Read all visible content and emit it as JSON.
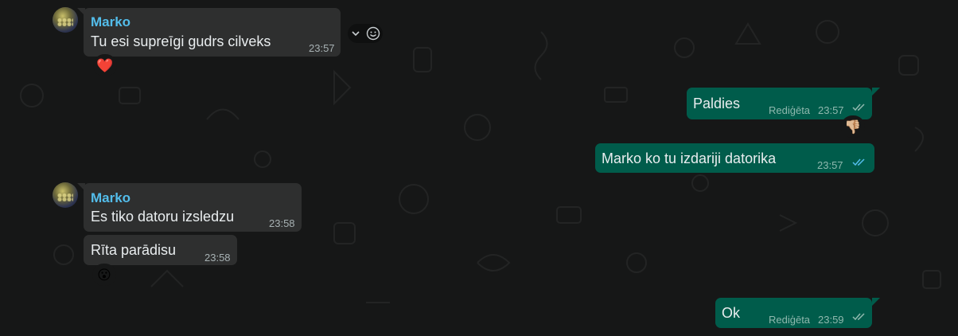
{
  "colors": {
    "background": "#161717",
    "incoming": "#2e2f2f",
    "outgoing": "#005c4b",
    "sender": "#53bdeb",
    "read_ticks": "#53bdeb"
  },
  "messages": [
    {
      "direction": "in",
      "sender": "Marko",
      "text": "Tu esi supreīgi gudrs cilveks",
      "time": "23:57",
      "reaction": "❤️"
    },
    {
      "direction": "out",
      "text": "Paldies",
      "edited": "Rediģēta",
      "time": "23:57",
      "reaction": "👎🏼",
      "status": "read"
    },
    {
      "direction": "out",
      "text": "Marko ko tu izdariji datorika",
      "time": "23:57",
      "status": "read"
    },
    {
      "direction": "in",
      "sender": "Marko",
      "text": "Es tiko datoru izsledzu",
      "time": "23:58"
    },
    {
      "direction": "in",
      "text": "Rīta parādisu",
      "time": "23:58",
      "reaction": "😮"
    },
    {
      "direction": "out",
      "text": "Ok",
      "edited": "Rediģēta",
      "time": "23:59",
      "status": "read"
    }
  ],
  "hover_actions": {
    "menu_icon": "chevron-down-icon",
    "react_icon": "smiley-icon"
  }
}
